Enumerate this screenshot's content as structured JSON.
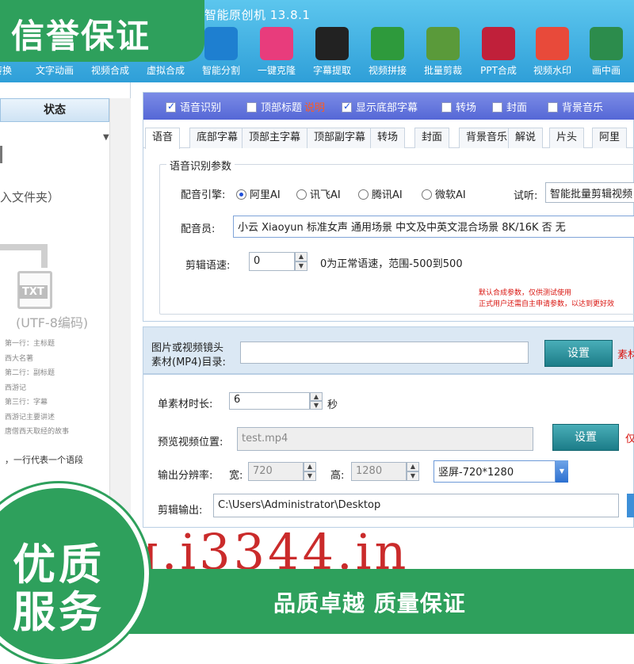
{
  "app": {
    "title": "智能原创机 13.8.1"
  },
  "toolbar": {
    "tools": [
      {
        "label": "转换",
        "icon": "convert-icon",
        "color": "#3a8fd6"
      },
      {
        "label": "文字动画",
        "icon": "text-animation-icon",
        "color": "#e86a2a"
      },
      {
        "label": "视频合成",
        "icon": "video-compose-icon",
        "color": "#ec5a4a"
      },
      {
        "label": "虚拟合成",
        "icon": "virtual-compose-icon",
        "color": "#3c80d8"
      },
      {
        "label": "智能分割",
        "icon": "smart-split-icon",
        "color": "#1e7fd0"
      },
      {
        "label": "一键克隆",
        "icon": "clone-icon",
        "color": "#e83c7c"
      },
      {
        "label": "字幕提取",
        "icon": "subtitle-extract-icon",
        "color": "#222222"
      },
      {
        "label": "视频拼接",
        "icon": "video-splice-icon",
        "color": "#2e9a3c"
      },
      {
        "label": "批量剪裁",
        "icon": "batch-crop-icon",
        "color": "#5a9a3a"
      },
      {
        "label": "PPT合成",
        "icon": "ppt-compose-icon",
        "color": "#c0203a"
      },
      {
        "label": "视频水印",
        "icon": "watermark-icon",
        "color": "#e84a3a"
      },
      {
        "label": "画中画",
        "icon": "pip-icon",
        "color": "#2c8c4c"
      }
    ]
  },
  "left_panel": {
    "header": "状态",
    "import_hint": "入文件夹）",
    "file_icon_label": "TXT",
    "encoding": "(UTF-8编码)",
    "sample_lines": [
      "第一行：主标题",
      "西大名著",
      "第二行：副标题",
      "西游记",
      "第三行：字幕",
      "西游记主要讲述",
      "唐僧西天取经的故事"
    ],
    "footer_hint": "，一行代表一个语段"
  },
  "check_bar": {
    "items": [
      {
        "label": "语音识别",
        "checked": true
      },
      {
        "label": "顶部标题",
        "checked": false,
        "link": "说明"
      },
      {
        "label": "显示底部字幕",
        "checked": true
      },
      {
        "label": "转场",
        "checked": false
      },
      {
        "label": "封面",
        "checked": false
      },
      {
        "label": "背景音乐",
        "checked": false
      }
    ]
  },
  "tabs": [
    "语音",
    "底部字幕",
    "顶部主字幕",
    "顶部副字幕",
    "转场",
    "封面",
    "背景音乐",
    "解说",
    "片头",
    "阿里"
  ],
  "speech": {
    "group_title": "语音识别参数",
    "engine_label": "配音引擎:",
    "engines": [
      {
        "label": "阿里AI",
        "selected": true
      },
      {
        "label": "讯飞AI",
        "selected": false
      },
      {
        "label": "腾讯AI",
        "selected": false
      },
      {
        "label": "微软AI",
        "selected": false
      }
    ],
    "preview_label": "试听:",
    "preview_value": "智能批量剪辑视频",
    "voice_label": "配音员:",
    "voice_value": "小云 Xiaoyun 标准女声 通用场景 中文及中英文混合场景 8K/16K 否 无",
    "speed_label": "剪辑语速:",
    "speed_value": "0",
    "speed_hint": "0为正常语速，范围-500到500",
    "note_line1": "默认合成参数，仅供测试使用",
    "note_line2": "正式用户还需自主申请参数，以达到更好效"
  },
  "material": {
    "label_line1": "图片或视频镜头",
    "label_line2": "素材(MP4)目录:",
    "path_value": "",
    "button": "设置",
    "side_text": "素材"
  },
  "settings": {
    "duration_label": "单素材时长:",
    "duration_value": "6",
    "duration_unit": "秒",
    "preview_pos_label": "预览视频位置:",
    "preview_pos_value": "test.mp4",
    "preview_button": "设置",
    "preview_side_text": "仅",
    "resolution_label": "输出分辨率:",
    "width_label": "宽:",
    "width_value": "720",
    "height_label": "高:",
    "height_value": "1280",
    "orientation_value": "竖屏-720*1280",
    "output_label": "剪辑输出:",
    "output_value": "C:\\Users\\Administrator\\Desktop"
  },
  "overlays": {
    "top_badge": "信誉保证",
    "watermark": "q.i3344.in",
    "circle_line1": "优质",
    "circle_line2": "服务",
    "bottom_banner": "品质卓越 质量保证",
    "brand_green": "#2ea05c"
  }
}
